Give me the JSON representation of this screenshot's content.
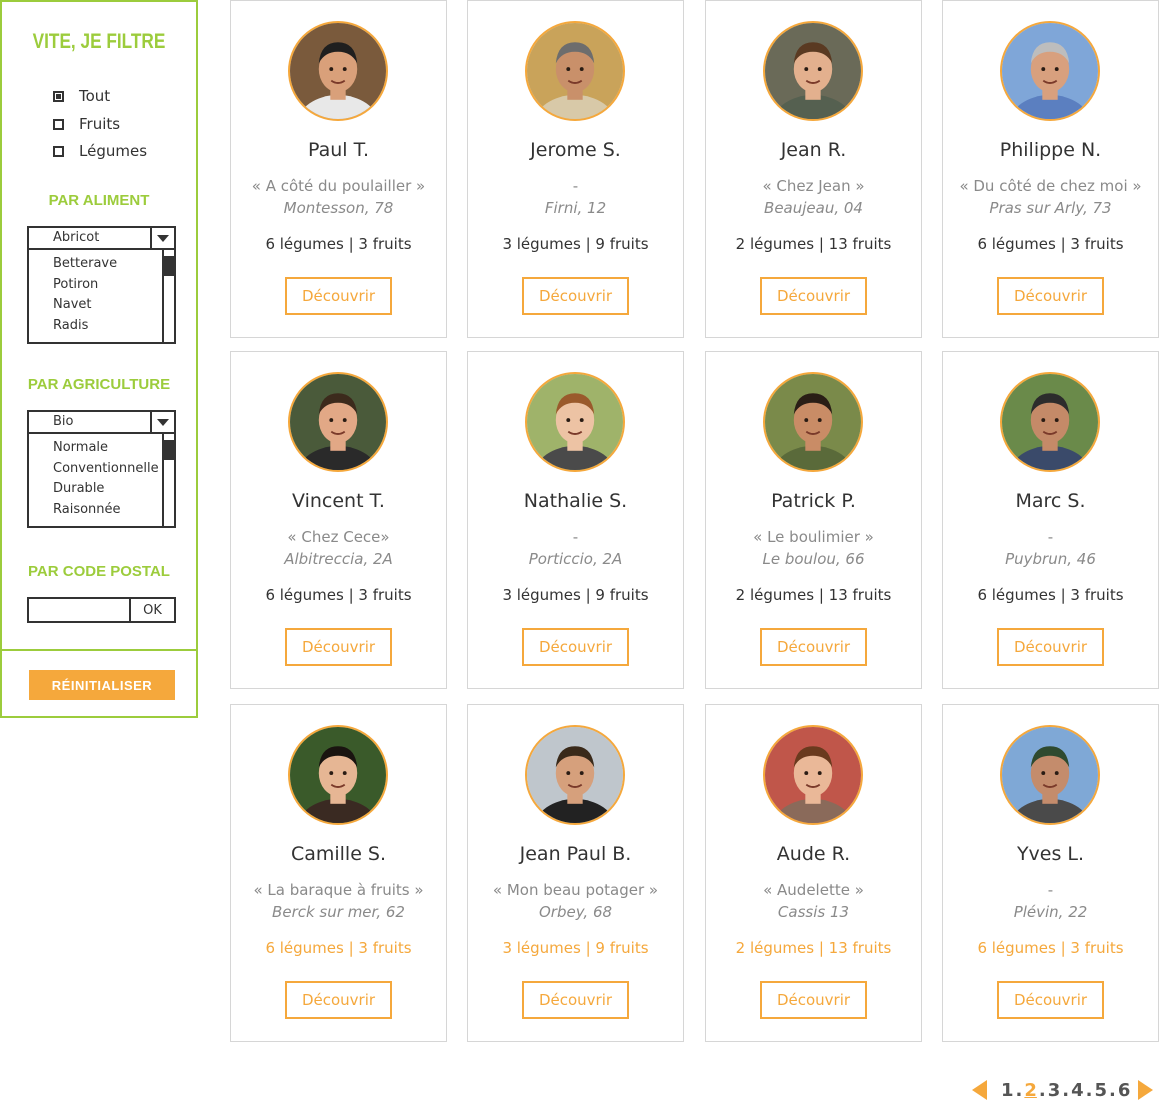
{
  "sidebar": {
    "title": "VITE, JE FILTRE",
    "type_filter": [
      {
        "label": "Tout",
        "checked": true
      },
      {
        "label": "Fruits",
        "checked": false
      },
      {
        "label": "Légumes",
        "checked": false
      }
    ],
    "aliment": {
      "title": "PAR ALIMENT",
      "selected": "Abricot",
      "options": [
        "Betterave",
        "Potiron",
        "Navet",
        "Radis"
      ]
    },
    "agriculture": {
      "title": "PAR AGRICULTURE",
      "selected": "Bio",
      "options": [
        "Normale",
        "Conventionnelle",
        "Durable",
        "Raisonnée"
      ]
    },
    "postal": {
      "title": "PAR CODE POSTAL",
      "value": "",
      "ok_label": "OK"
    },
    "reset_label": "RÉINITIALISER"
  },
  "cards": [
    {
      "name": "Paul T.",
      "quote": "« A côté du poulailler »",
      "place": "Montesson, 78",
      "counts": "6 légumes | 3 fruits",
      "button": "Découvrir",
      "skin": "#d9a07a",
      "hair": "#1f1f1f",
      "shirt": "#e8e8e8",
      "bg": "#7a5a3c"
    },
    {
      "name": "Jerome S.",
      "quote": "-",
      "place": "Firni, 12",
      "counts": "3 légumes | 9 fruits",
      "button": "Découvrir",
      "skin": "#c9906a",
      "hair": "#6d6d6d",
      "shirt": "#d8c9a8",
      "bg": "#c9a35a"
    },
    {
      "name": "Jean R.",
      "quote": "« Chez Jean »",
      "place": "Beaujeau, 04",
      "counts": "2 légumes | 13 fruits",
      "button": "Découvrir",
      "skin": "#e3b08e",
      "hair": "#5a3a22",
      "shirt": "#556050",
      "bg": "#6a6a58"
    },
    {
      "name": "Philippe N.",
      "quote": "« Du côté de chez moi »",
      "place": "Pras sur Arly, 73",
      "counts": "6 légumes | 3 fruits",
      "button": "Découvrir",
      "skin": "#d8a07e",
      "hair": "#bdbdbd",
      "shirt": "#5b7fc0",
      "bg": "#7fa6d8"
    },
    {
      "name": "Vincent T.",
      "quote": "« Chez Cece»",
      "place": "Albitreccia, 2A",
      "counts": "6 légumes | 3 fruits",
      "button": "Découvrir",
      "skin": "#e2a886",
      "hair": "#3c2a1c",
      "shirt": "#2a2a2a",
      "bg": "#4a5a3a"
    },
    {
      "name": "Nathalie S.",
      "quote": "-",
      "place": "Porticcio, 2A",
      "counts": "3 légumes | 9 fruits",
      "button": "Découvrir",
      "skin": "#edc3a4",
      "hair": "#9a5a2c",
      "shirt": "#4a4a4a",
      "bg": "#9fb36a"
    },
    {
      "name": "Patrick P.",
      "quote": "« Le boulimier »",
      "place": "Le boulou, 66",
      "counts": "2 légumes | 13 fruits",
      "button": "Découvrir",
      "skin": "#c98c66",
      "hair": "#2a1e16",
      "shirt": "#5a6a3a",
      "bg": "#7a8a4a"
    },
    {
      "name": "Marc S.",
      "quote": "-",
      "place": "Puybrun, 46",
      "counts": "6 légumes | 3 fruits",
      "button": "Découvrir",
      "skin": "#c48a68",
      "hair": "#2c2c2c",
      "shirt": "#3a4a6a",
      "bg": "#6a8a4a"
    },
    {
      "name": "Camille S.",
      "quote": "« La baraque à fruits  »",
      "place": "Berck sur mer, 62",
      "counts": "6 légumes | 3 fruits",
      "button": "Découvrir",
      "skin": "#e6b694",
      "hair": "#1a1410",
      "shirt": "#3a2a22",
      "bg": "#3a5a2a"
    },
    {
      "name": "Jean Paul B.",
      "quote": "« Mon beau potager »",
      "place": "Orbey, 68",
      "counts": "3 légumes | 9 fruits",
      "button": "Découvrir",
      "skin": "#d6a07c",
      "hair": "#3a2a1a",
      "shirt": "#222222",
      "bg": "#bfc6cc"
    },
    {
      "name": "Aude R.",
      "quote": "« Audelette »",
      "place": "Cassis 13",
      "counts": "2 légumes | 13 fruits",
      "button": "Découvrir",
      "skin": "#eab898",
      "hair": "#6a3a1e",
      "shirt": "#8a6a5a",
      "bg": "#c0564a"
    },
    {
      "name": "Yves L.",
      "quote": "-",
      "place": "Plévin, 22",
      "counts": "6 légumes | 3 fruits",
      "button": "Découvrir",
      "skin": "#c48c6c",
      "hair": "#2f4a2f",
      "shirt": "#4a4a4a",
      "bg": "#7fa8d6"
    }
  ],
  "pagination": {
    "pages": [
      "1",
      "2",
      "3",
      "4",
      "5",
      "6"
    ],
    "current": "2"
  },
  "colors": {
    "accent_green": "#9ccc3c",
    "accent_orange": "#f5a83c"
  }
}
